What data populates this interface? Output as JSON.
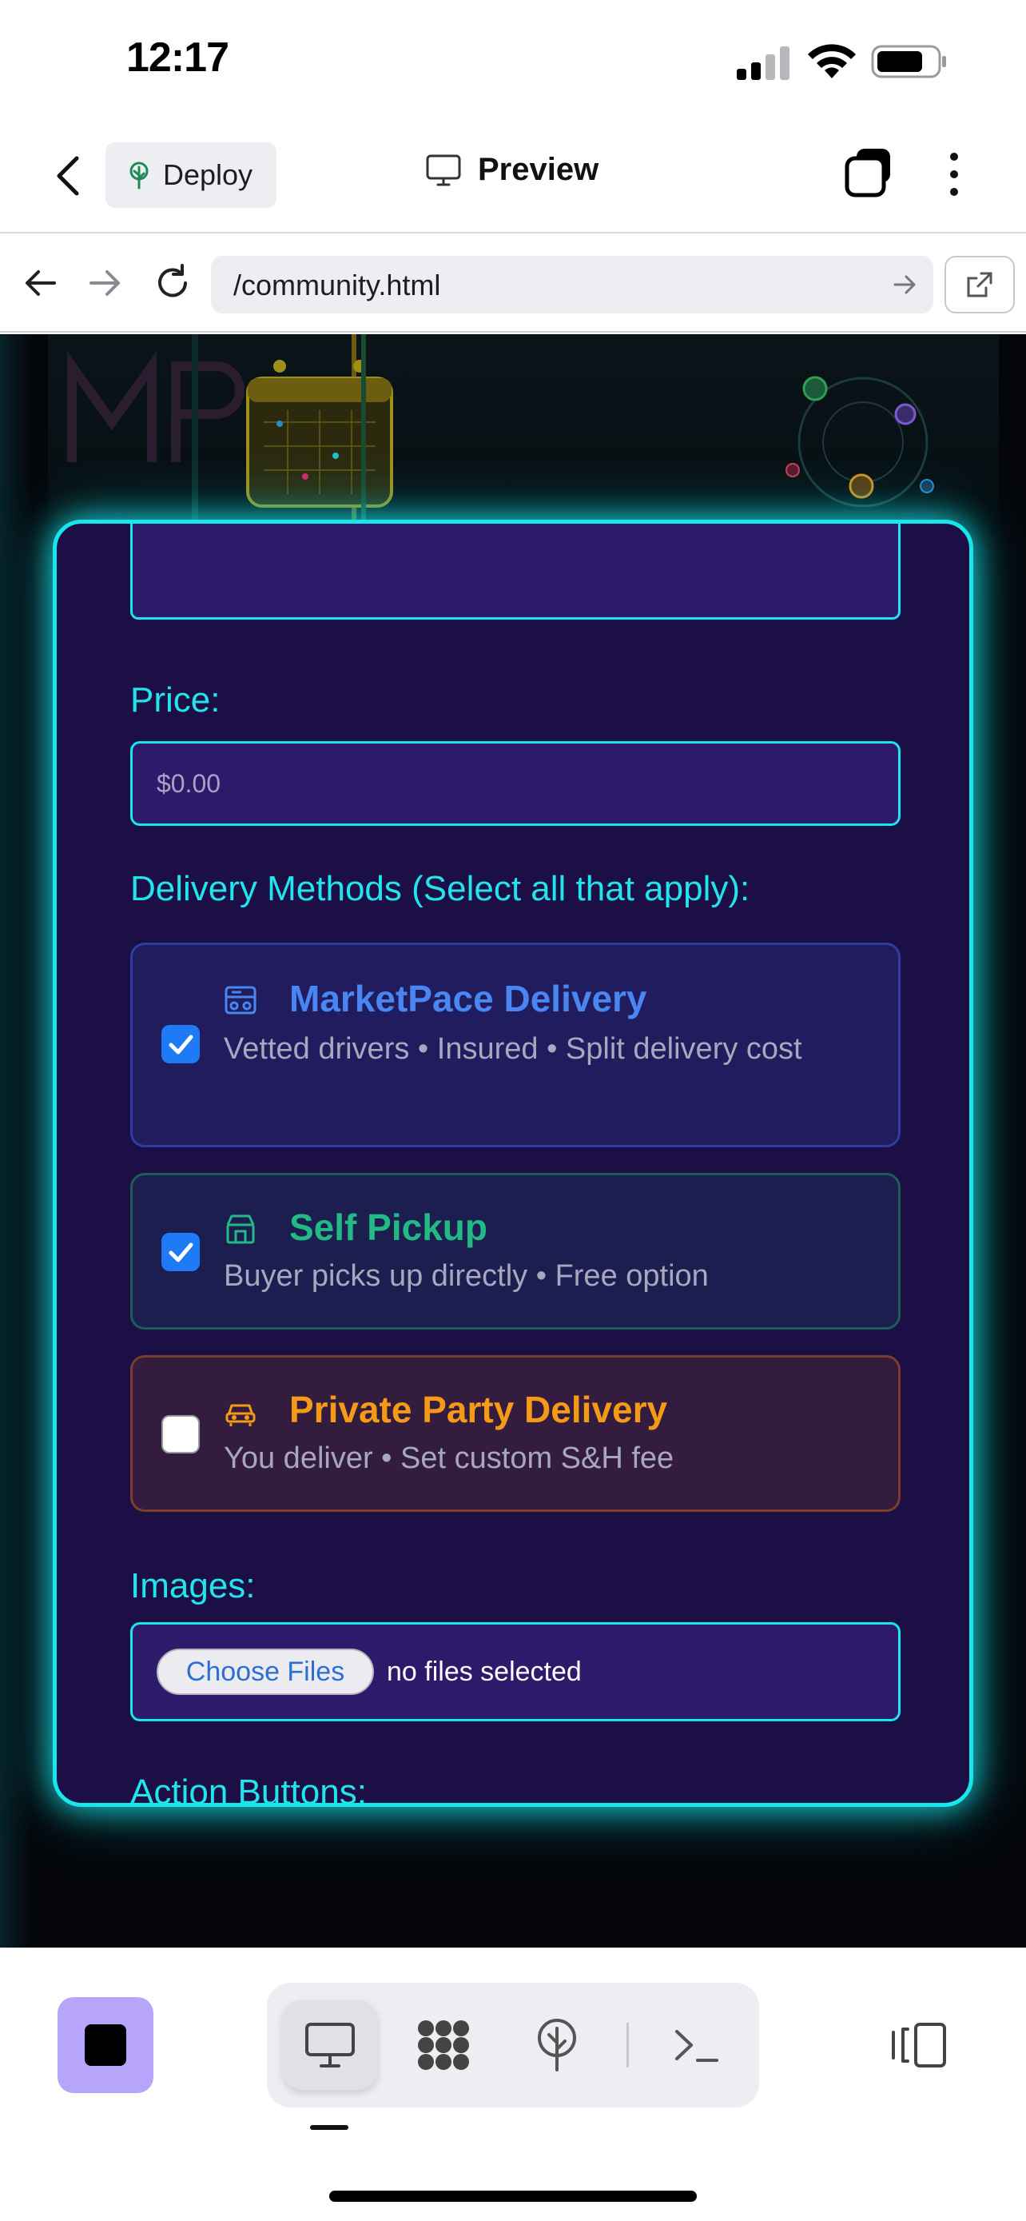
{
  "status_bar": {
    "time": "12:17"
  },
  "toolbar": {
    "deploy_label": "Deploy",
    "preview_label": "Preview"
  },
  "browser": {
    "url": "/community.html"
  },
  "form": {
    "price_label": "Price:",
    "price_placeholder": "$0.00",
    "delivery_label": "Delivery Methods (Select all that apply):",
    "delivery_options": [
      {
        "title": "MarketPace Delivery",
        "description": "Vetted drivers • Insured • Split delivery cost",
        "checked": true,
        "color": "#4a86f2",
        "icon": "truck-icon"
      },
      {
        "title": "Self Pickup",
        "description": "Buyer picks up directly • Free option",
        "checked": true,
        "color": "#22b984",
        "icon": "store-icon"
      },
      {
        "title": "Private Party Delivery",
        "description": "You deliver • Set custom S&H fee",
        "checked": false,
        "color": "#f59a16",
        "icon": "car-icon"
      }
    ],
    "images_label": "Images:",
    "choose_files_label": "Choose Files",
    "no_files_text": "no files selected",
    "action_buttons_label": "Action Buttons:"
  },
  "colors": {
    "accent_cyan": "#19e6ea",
    "card_bg": "#1c0f45",
    "input_bg": "#2d1a6b",
    "stop_button": "#b7a5fb"
  }
}
